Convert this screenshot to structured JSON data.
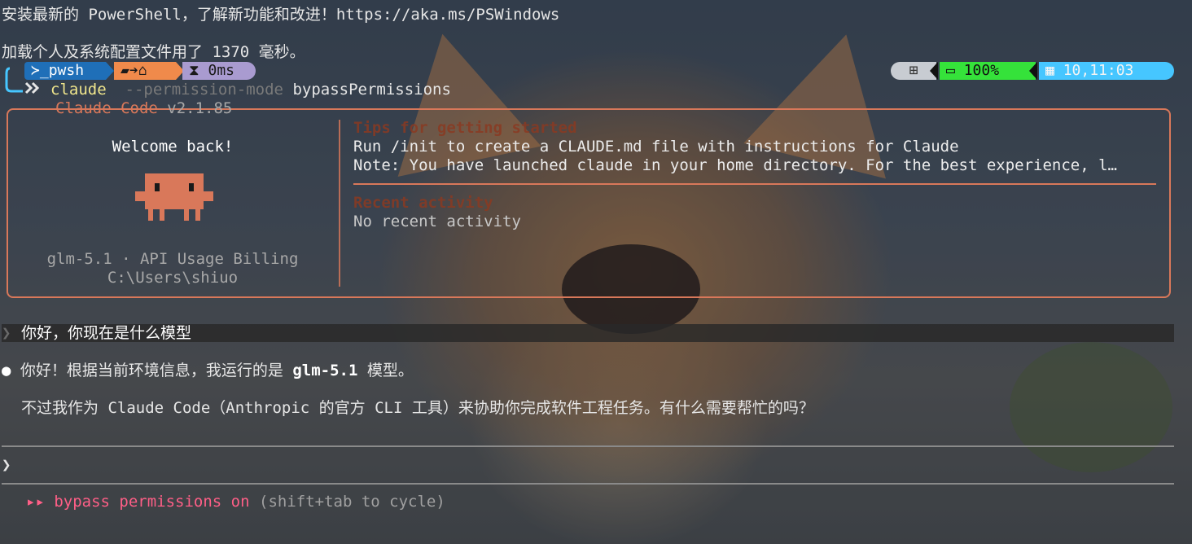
{
  "terminal": {
    "line1": "安装最新的 PowerShell，了解新功能和改进！https://aka.ms/PSWindows",
    "line2": "加载个人及系统配置文件用了 1370 毫秒。"
  },
  "prompt": {
    "shell": "pwsh",
    "duration": "0ms",
    "battery": "100%",
    "time": "10,11:03",
    "command": "claude",
    "flag": "--permission-mode",
    "flag_value": "bypassPermissions",
    "colors": {
      "shell_bg": "#1f6fb8",
      "path_bg": "#f08a4b",
      "duration_bg": "#a99bd0",
      "os_bg": "#c8ccd2",
      "battery_bg": "#35e23a",
      "time_bg": "#46c6ff"
    }
  },
  "welcome_box": {
    "title": "Claude Code",
    "version": "v2.1.85",
    "greeting": "Welcome back!",
    "model_info": "glm-5.1 · API Usage Billing",
    "cwd": "C:\\Users\\shiuo",
    "tips_heading": "Tips for getting started",
    "tip1": "Run /init to create a CLAUDE.md file with instructions for Claude",
    "tip2": "Note: You have launched claude in your home directory. For the best experience, l…",
    "recent_heading": "Recent activity",
    "recent_empty": "No recent activity",
    "accent": "#d9785a"
  },
  "conversation": {
    "user_prompt_marker": "❯",
    "user_message": "你好，你现在是什么模型",
    "reply_bullet": "●",
    "reply_line1_pre": "你好！根据当前环境信息，我运行的是 ",
    "reply_model": "glm-5.1",
    "reply_line1_post": " 模型。",
    "reply_line2": "不过我作为 Claude Code（Anthropic 的官方 CLI 工具）来协助你完成软件工程任务。有什么需要帮忙的吗？"
  },
  "input": {
    "prompt_marker": "❯",
    "value": ""
  },
  "status": {
    "mode_icon": "▸▸",
    "mode_text": "bypass permissions on",
    "hint": "(shift+tab to cycle)",
    "color": "#ff5f87"
  }
}
